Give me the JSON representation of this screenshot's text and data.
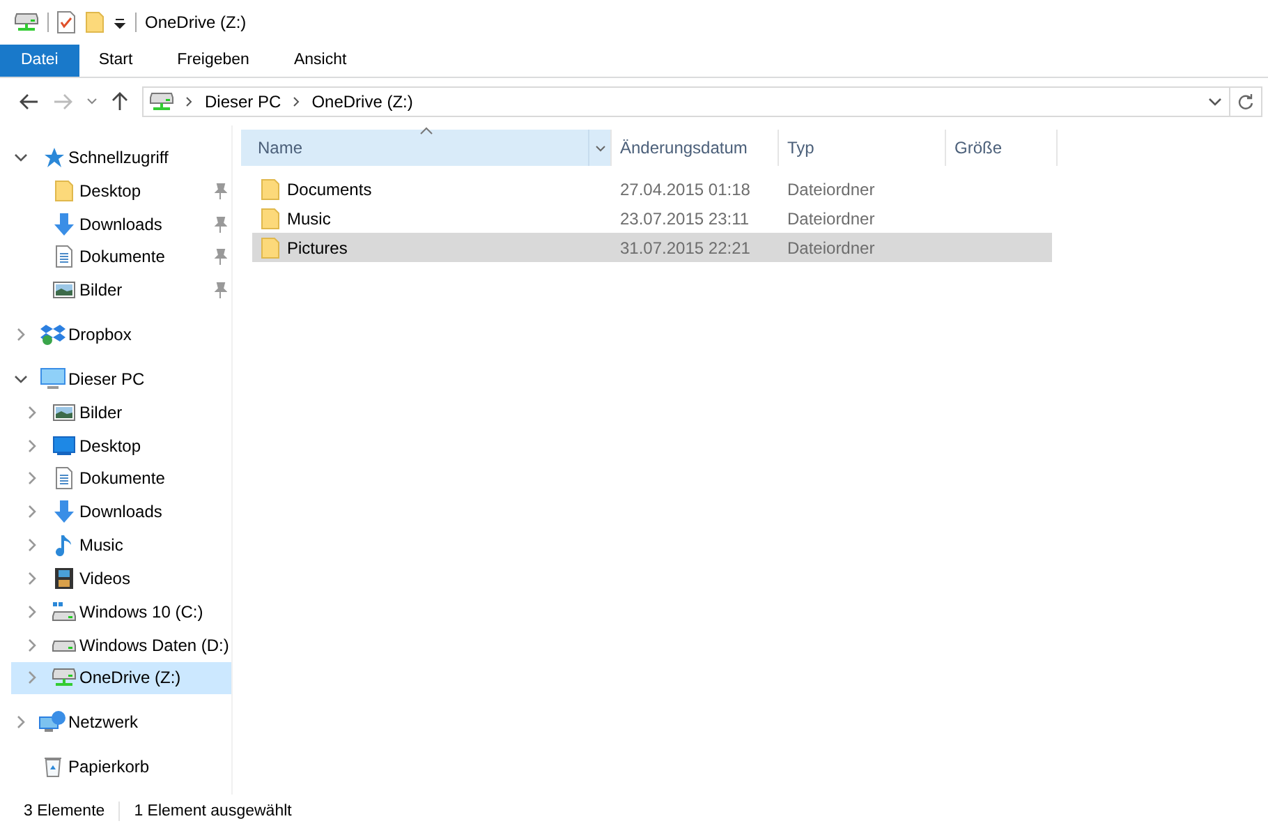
{
  "window": {
    "title": "OneDrive (Z:)"
  },
  "ribbon": {
    "tabs": [
      {
        "label": "Datei",
        "selected": true
      },
      {
        "label": "Start",
        "selected": false
      },
      {
        "label": "Freigeben",
        "selected": false
      },
      {
        "label": "Ansicht",
        "selected": false
      }
    ]
  },
  "address_bar": {
    "path": [
      "Dieser PC",
      "OneDrive (Z:)"
    ]
  },
  "sidebar": {
    "items": [
      {
        "label": "Schnellzugriff",
        "kind": "star",
        "expanded": true,
        "selected": false,
        "children": [
          {
            "label": "Desktop",
            "kind": "folder",
            "pinned": true,
            "selected": false
          },
          {
            "label": "Downloads",
            "kind": "download",
            "pinned": true,
            "selected": false
          },
          {
            "label": "Dokumente",
            "kind": "document",
            "pinned": true,
            "selected": false
          },
          {
            "label": "Bilder",
            "kind": "pictures",
            "pinned": true,
            "selected": false
          }
        ]
      },
      {
        "label": "Dropbox",
        "kind": "dropbox",
        "expanded": false,
        "selected": false
      },
      {
        "label": "Dieser PC",
        "kind": "pc",
        "expanded": true,
        "selected": false,
        "children": [
          {
            "label": "Bilder",
            "kind": "pictures",
            "expanded": false,
            "selected": false
          },
          {
            "label": "Desktop",
            "kind": "desktop",
            "expanded": false,
            "selected": false
          },
          {
            "label": "Dokumente",
            "kind": "document",
            "expanded": false,
            "selected": false
          },
          {
            "label": "Downloads",
            "kind": "download",
            "expanded": false,
            "selected": false
          },
          {
            "label": "Music",
            "kind": "music",
            "expanded": false,
            "selected": false
          },
          {
            "label": "Videos",
            "kind": "video",
            "expanded": false,
            "selected": false
          },
          {
            "label": "Windows 10 (C:)",
            "kind": "system-drive",
            "expanded": false,
            "selected": false
          },
          {
            "label": "Windows Daten (D:)",
            "kind": "drive",
            "expanded": false,
            "selected": false
          },
          {
            "label": "OneDrive (Z:)",
            "kind": "network-drive",
            "expanded": false,
            "selected": true
          }
        ]
      },
      {
        "label": "Netzwerk",
        "kind": "network",
        "expanded": false,
        "selected": false
      },
      {
        "label": "Papierkorb",
        "kind": "recycle",
        "selected": false
      }
    ]
  },
  "table": {
    "columns": [
      {
        "label": "Name",
        "sorted": true,
        "hovered": true
      },
      {
        "label": "Änderungsdatum",
        "sorted": false,
        "hovered": false
      },
      {
        "label": "Typ",
        "sorted": false,
        "hovered": false
      },
      {
        "label": "Größe",
        "sorted": false,
        "hovered": false
      }
    ],
    "rows": [
      {
        "name": "Documents",
        "modified": "27.04.2015 01:18",
        "type": "Dateiordner",
        "selected": false
      },
      {
        "name": "Music",
        "modified": "23.07.2015 23:11",
        "type": "Dateiordner",
        "selected": false
      },
      {
        "name": "Pictures",
        "modified": "31.07.2015 22:21",
        "type": "Dateiordner",
        "selected": true
      }
    ]
  },
  "status_bar": {
    "items": [
      "3 Elemente",
      "1 Element ausgewählt"
    ]
  }
}
